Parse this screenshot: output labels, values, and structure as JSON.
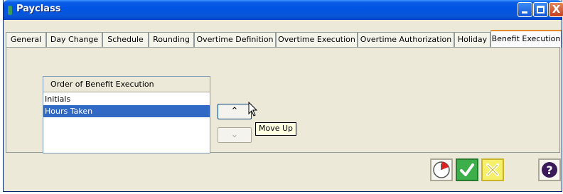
{
  "window": {
    "title": "Payclass",
    "close_glyph": "X"
  },
  "tabs": [
    {
      "label": "General"
    },
    {
      "label": "Day Change"
    },
    {
      "label": "Schedule"
    },
    {
      "label": "Rounding"
    },
    {
      "label": "Overtime Definition"
    },
    {
      "label": "Overtime Execution"
    },
    {
      "label": "Overtime Authorization"
    },
    {
      "label": "Holiday"
    },
    {
      "label": "Benefit Execution"
    }
  ],
  "active_tab": "Benefit Execution",
  "benefit_list": {
    "header": "Order of Benefit Execution",
    "rows": [
      "Initials",
      "Hours Taken"
    ],
    "selected": "Hours Taken"
  },
  "move": {
    "up_glyph": "⌃",
    "down_glyph": "⌄",
    "tooltip": "Move Up"
  },
  "actions": {
    "help_glyph": "?"
  },
  "icons": {
    "clock": "clock-icon",
    "ok": "checkmark-icon",
    "cancel": "x-mark-icon",
    "help": "question-mark-icon"
  },
  "colors": {
    "titlebar": "#0054e3",
    "selection": "#316ac5",
    "active_tab_accent": "#e68b2c",
    "ok_button": "#3cae4a",
    "cancel_button": "#f6ef6a"
  }
}
